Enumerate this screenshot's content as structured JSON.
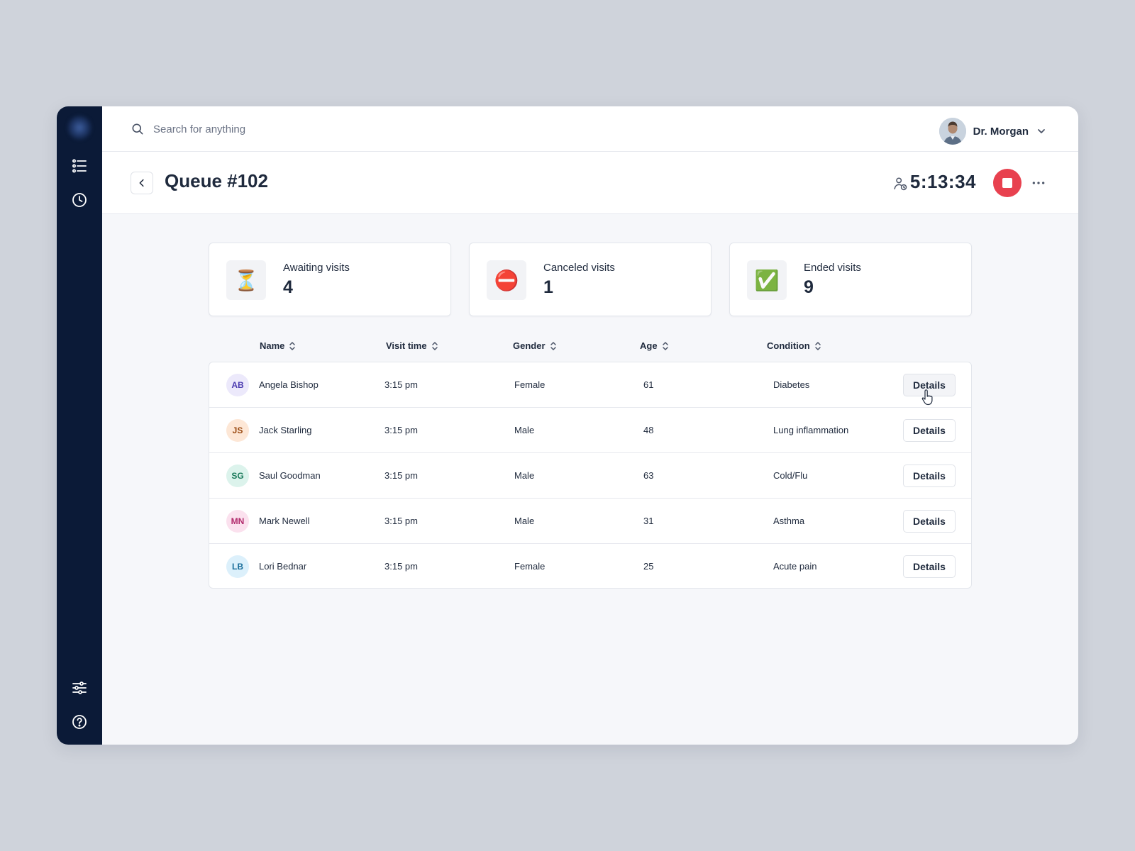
{
  "search": {
    "placeholder": "Search for anything"
  },
  "user": {
    "name": "Dr. Morgan"
  },
  "header": {
    "title": "Queue #102",
    "timer": "5:13:34"
  },
  "stats": [
    {
      "icon": "hourglass-icon",
      "glyph": "⏳",
      "label": "Awaiting visits",
      "value": "4"
    },
    {
      "icon": "no-entry-icon",
      "glyph": "⛔",
      "label": "Canceled visits",
      "value": "1"
    },
    {
      "icon": "check-mark-icon",
      "glyph": "✅",
      "label": "Ended visits",
      "value": "9"
    }
  ],
  "table": {
    "columns": [
      "Name",
      "Visit time",
      "Gender",
      "Age",
      "Condition"
    ],
    "action_label": "Details",
    "rows": [
      {
        "initials": "AB",
        "name": "Angela Bishop",
        "time": "3:15 pm",
        "gender": "Female",
        "age": "61",
        "condition": "Diabetes",
        "avatar_bg": "#ece9fb",
        "avatar_fg": "#4b3bb0"
      },
      {
        "initials": "JS",
        "name": "Jack Starling",
        "time": "3:15 pm",
        "gender": "Male",
        "age": "48",
        "condition": "Lung inflammation",
        "avatar_bg": "#fde7d6",
        "avatar_fg": "#9a4a12"
      },
      {
        "initials": "SG",
        "name": "Saul Goodman",
        "time": "3:15 pm",
        "gender": "Male",
        "age": "63",
        "condition": "Cold/Flu",
        "avatar_bg": "#dcf3ec",
        "avatar_fg": "#1b7a5b"
      },
      {
        "initials": "MN",
        "name": "Mark Newell",
        "time": "3:15 pm",
        "gender": "Male",
        "age": "31",
        "condition": "Asthma",
        "avatar_bg": "#fbe1ee",
        "avatar_fg": "#b12a6c"
      },
      {
        "initials": "LB",
        "name": "Lori Bednar",
        "time": "3:15 pm",
        "gender": "Female",
        "age": "25",
        "condition": "Acute pain",
        "avatar_bg": "#dcf0fb",
        "avatar_fg": "#1b6e9a"
      }
    ]
  },
  "colors": {
    "sidebar": "#0b1a37",
    "stop_button": "#e8414f",
    "text": "#1f2a3d"
  }
}
